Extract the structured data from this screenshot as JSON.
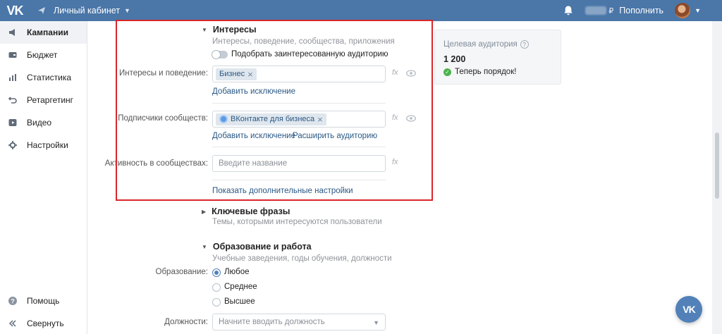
{
  "header": {
    "logo": "VK",
    "cabinet_label": "Личный кабинет",
    "topup_label": "Пополнить",
    "currency": "₽"
  },
  "sidebar": {
    "items": [
      {
        "label": "Кампании",
        "icon": "megaphone-icon",
        "active": true
      },
      {
        "label": "Бюджет",
        "icon": "wallet-icon"
      },
      {
        "label": "Статистика",
        "icon": "bar-chart-icon"
      },
      {
        "label": "Ретаргетинг",
        "icon": "retarget-icon"
      },
      {
        "label": "Видео",
        "icon": "video-icon"
      },
      {
        "label": "Настройки",
        "icon": "gear-icon"
      }
    ],
    "bottom": [
      {
        "label": "Помощь",
        "icon": "help-icon"
      },
      {
        "label": "Свернуть",
        "icon": "collapse-icon"
      }
    ]
  },
  "interests": {
    "title": "Интересы",
    "subtitle": "Интересы, поведение, сообщества, приложения",
    "toggle_label": "Подобрать заинтересованную аудиторию",
    "interests_label": "Интересы и поведение:",
    "interests_chip": "Бизнес",
    "add_exclusion": "Добавить исключение",
    "subscribers_label": "Подписчики сообществ:",
    "subscribers_chip": "ВКонтакте для бизнеса",
    "expand_audience": "Расширить аудиторию",
    "activity_label": "Активность в сообществах:",
    "activity_placeholder": "Введите название",
    "more_settings": "Показать дополнительные настройки",
    "fx": "fx"
  },
  "keywords": {
    "title": "Ключевые фразы",
    "subtitle": "Темы, которыми интересуются пользователи"
  },
  "education": {
    "title": "Образование и работа",
    "subtitle": "Учебные заведения, годы обучения, должности",
    "education_label": "Образование:",
    "options": [
      "Любое",
      "Среднее",
      "Высшее"
    ],
    "selected": "Любое",
    "positions_label": "Должности:",
    "positions_placeholder": "Начните вводить должность"
  },
  "audience": {
    "title": "Целевая аудитория",
    "count": "1 200",
    "status": "Теперь порядок!"
  },
  "colors": {
    "header": "#4a76a8",
    "link": "#2a5885",
    "highlight_border": "#d9262b",
    "success": "#4bb34b"
  }
}
